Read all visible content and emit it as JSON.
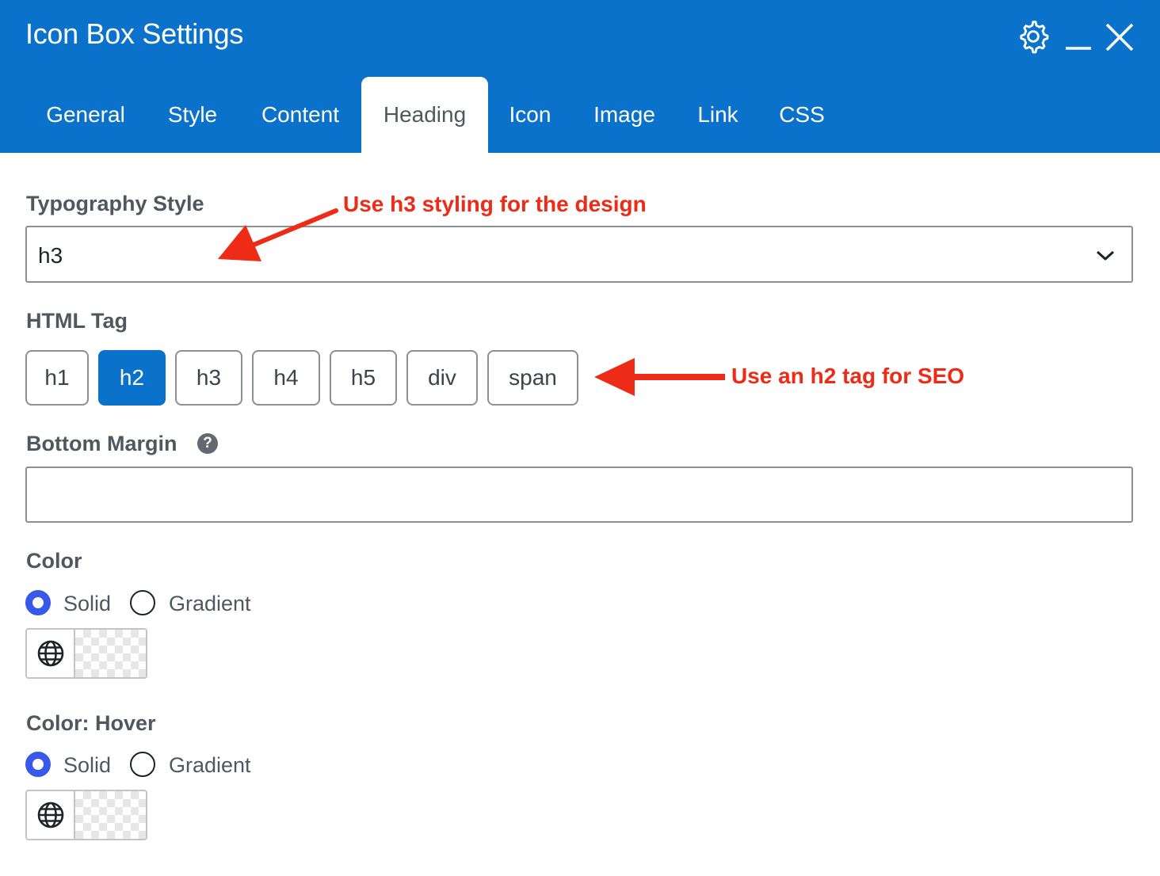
{
  "window": {
    "title": "Icon Box Settings",
    "icons": [
      "gear-icon",
      "minimize-icon",
      "close-icon"
    ]
  },
  "tabs": [
    {
      "label": "General",
      "active": false
    },
    {
      "label": "Style",
      "active": false
    },
    {
      "label": "Content",
      "active": false
    },
    {
      "label": "Heading",
      "active": true
    },
    {
      "label": "Icon",
      "active": false
    },
    {
      "label": "Image",
      "active": false
    },
    {
      "label": "Link",
      "active": false
    },
    {
      "label": "CSS",
      "active": false
    }
  ],
  "typography": {
    "label": "Typography Style",
    "value": "h3"
  },
  "html_tag": {
    "label": "HTML Tag",
    "options": [
      "h1",
      "h2",
      "h3",
      "h4",
      "h5",
      "div",
      "span"
    ],
    "selected": "h2"
  },
  "bottom_margin": {
    "label": "Bottom Margin",
    "help": "?",
    "value": ""
  },
  "color": {
    "label": "Color",
    "options": [
      "Solid",
      "Gradient"
    ],
    "selected": "Solid"
  },
  "color_hover": {
    "label": "Color: Hover",
    "options": [
      "Solid",
      "Gradient"
    ],
    "selected": "Solid"
  },
  "annotations": {
    "typography_note": "Use h3 styling for the design",
    "tag_note": "Use an h2 tag for SEO"
  },
  "colors": {
    "header": "#0b72cc",
    "active_button": "#0b72cc",
    "radio_accent": "#3858e9",
    "annotation": "#ee2b16"
  }
}
